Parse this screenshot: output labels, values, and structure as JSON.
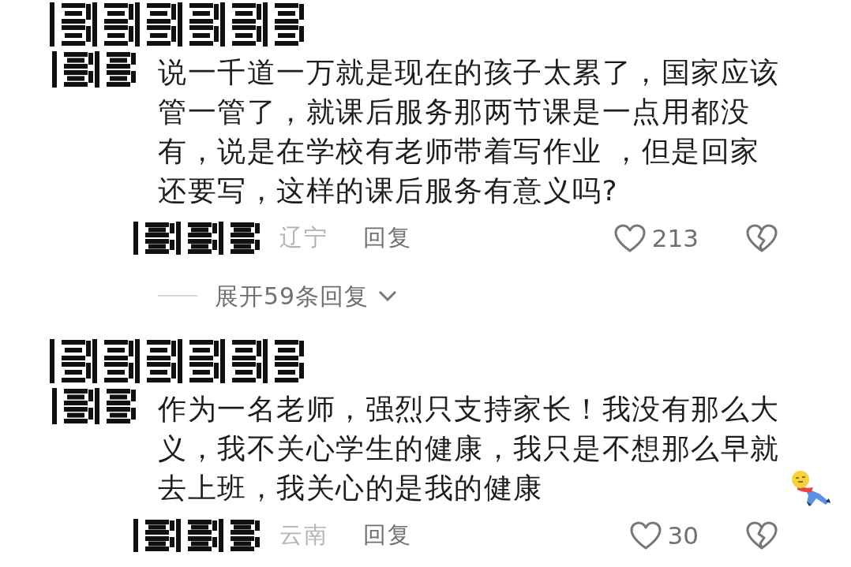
{
  "comments": [
    {
      "text": "说一千道一万就是现在的孩子太累了，国家应该管一管了，就课后服务那两节课是一点用都没有，说是在学校有老师带着写作业 ，但是回家还要写，这样的课后服务有意义吗?",
      "sticker": false,
      "location": "辽宁",
      "reply_label": "回复",
      "likes": "213",
      "expand_replies": "展开59条回复"
    },
    {
      "text": "作为一名老师，强烈只支持家长！我没有那么大义，我不关心学生的健康，我只是不想那么早就去上班，我关心的是我的健康",
      "sticker": true,
      "location": "云南",
      "reply_label": "回复",
      "likes": "30"
    }
  ]
}
